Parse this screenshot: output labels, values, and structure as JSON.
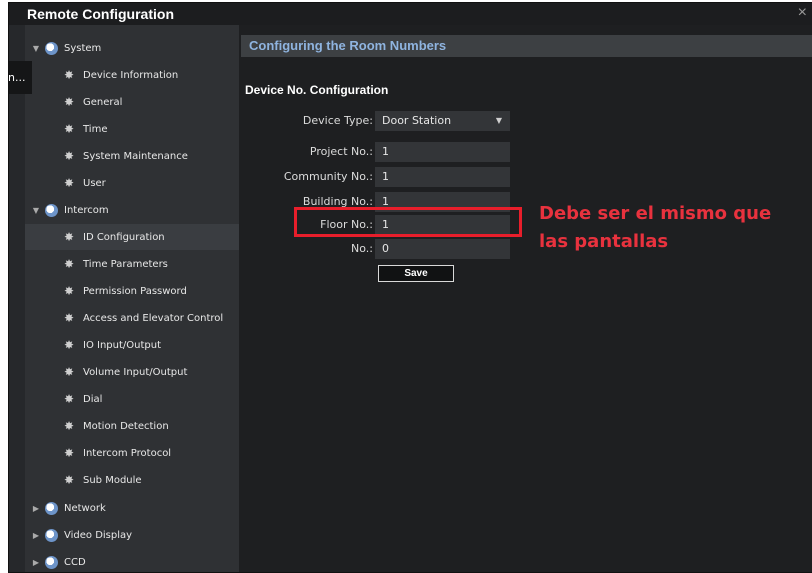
{
  "window": {
    "title": "Remote Configuration",
    "close_symbol": "×"
  },
  "left_stub_text": "n...",
  "sidebar": {
    "items": [
      {
        "label": "System",
        "type": "category",
        "expanded": true,
        "icon": "system-icon"
      },
      {
        "label": "Device Information",
        "type": "child",
        "icon": "gear-icon"
      },
      {
        "label": "General",
        "type": "child",
        "icon": "gear-icon"
      },
      {
        "label": "Time",
        "type": "child",
        "icon": "gear-icon"
      },
      {
        "label": "System Maintenance",
        "type": "child",
        "icon": "gear-icon"
      },
      {
        "label": "User",
        "type": "child",
        "icon": "gear-icon"
      },
      {
        "label": "Intercom",
        "type": "category",
        "expanded": true,
        "icon": "intercom-icon"
      },
      {
        "label": "ID Configuration",
        "type": "child",
        "selected": true,
        "icon": "gear-icon"
      },
      {
        "label": "Time Parameters",
        "type": "child",
        "icon": "gear-icon"
      },
      {
        "label": "Permission Password",
        "type": "child",
        "icon": "gear-icon"
      },
      {
        "label": "Access and Elevator Control",
        "type": "child",
        "icon": "gear-icon"
      },
      {
        "label": "IO Input/Output",
        "type": "child",
        "icon": "gear-icon"
      },
      {
        "label": "Volume Input/Output",
        "type": "child",
        "icon": "gear-icon"
      },
      {
        "label": "Dial",
        "type": "child",
        "icon": "gear-icon"
      },
      {
        "label": "Motion Detection",
        "type": "child",
        "icon": "gear-icon"
      },
      {
        "label": "Intercom Protocol",
        "type": "child",
        "icon": "gear-icon"
      },
      {
        "label": "Sub Module",
        "type": "child",
        "icon": "gear-icon"
      },
      {
        "label": "Network",
        "type": "category",
        "expanded": false,
        "icon": "network-icon"
      },
      {
        "label": "Video Display",
        "type": "category",
        "expanded": false,
        "icon": "video-icon"
      },
      {
        "label": "CCD",
        "type": "category",
        "expanded": false,
        "icon": "ccd-icon"
      }
    ]
  },
  "content": {
    "panel_title": "Configuring the Room Numbers",
    "section_title": "Device No. Configuration",
    "fields": {
      "device_type": {
        "label": "Device Type:",
        "value": "Door Station"
      },
      "project_no": {
        "label": "Project No.:",
        "value": "1"
      },
      "community_no": {
        "label": "Community No.:",
        "value": "1"
      },
      "building_no": {
        "label": "Building No.:",
        "value": "1"
      },
      "floor_no": {
        "label": "Floor No.:",
        "value": "1"
      },
      "no": {
        "label": "No.:",
        "value": "0"
      }
    },
    "save_label": "Save"
  },
  "annotation": {
    "line1": "Debe ser el mismo que",
    "line2": "las pantallas",
    "color": "#e8323e"
  }
}
